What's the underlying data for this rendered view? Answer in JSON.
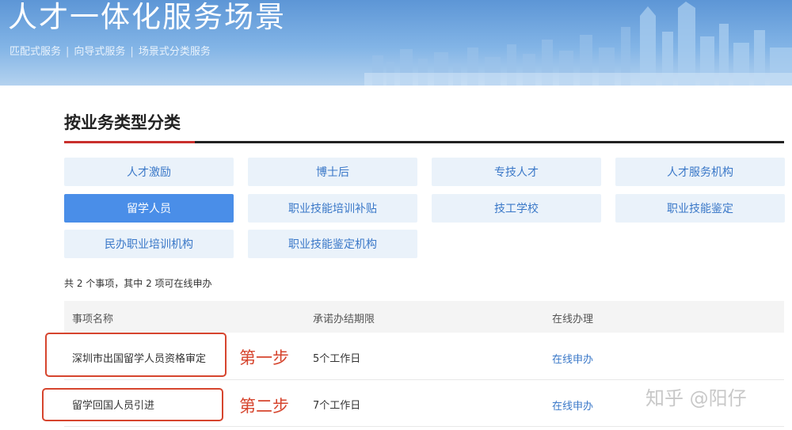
{
  "banner": {
    "title": "人才一体化服务场景",
    "subtitle_items": [
      "匹配式服务",
      "向导式服务",
      "场景式分类服务"
    ],
    "separator": "|"
  },
  "section": {
    "title": "按业务类型分类"
  },
  "categories": [
    {
      "label": "人才激励",
      "active": false
    },
    {
      "label": "博士后",
      "active": false
    },
    {
      "label": "专技人才",
      "active": false
    },
    {
      "label": "人才服务机构",
      "active": false
    },
    {
      "label": "留学人员",
      "active": true
    },
    {
      "label": "职业技能培训补贴",
      "active": false
    },
    {
      "label": "技工学校",
      "active": false
    },
    {
      "label": "职业技能鉴定",
      "active": false
    },
    {
      "label": "民办职业培训机构",
      "active": false
    },
    {
      "label": "职业技能鉴定机构",
      "active": false
    }
  ],
  "summary": "共 2 个事项，其中 2 项可在线申办",
  "table": {
    "headers": [
      "事项名称",
      "承诺办结期限",
      "在线办理"
    ],
    "rows": [
      {
        "name": "深圳市出国留学人员资格审定",
        "deadline": "5个工作日",
        "action": "在线申办"
      },
      {
        "name": "留学回国人员引进",
        "deadline": "7个工作日",
        "action": "在线申办"
      }
    ]
  },
  "annotations": {
    "step1": "第一步",
    "step2": "第二步"
  },
  "watermark": "知乎 @阳仔",
  "colors": {
    "accent": "#4a8ee8",
    "link": "#3a78c8",
    "category_bg": "#eaf2fa",
    "annotation_red": "#d6452e",
    "title_underline": "#c9302c"
  }
}
